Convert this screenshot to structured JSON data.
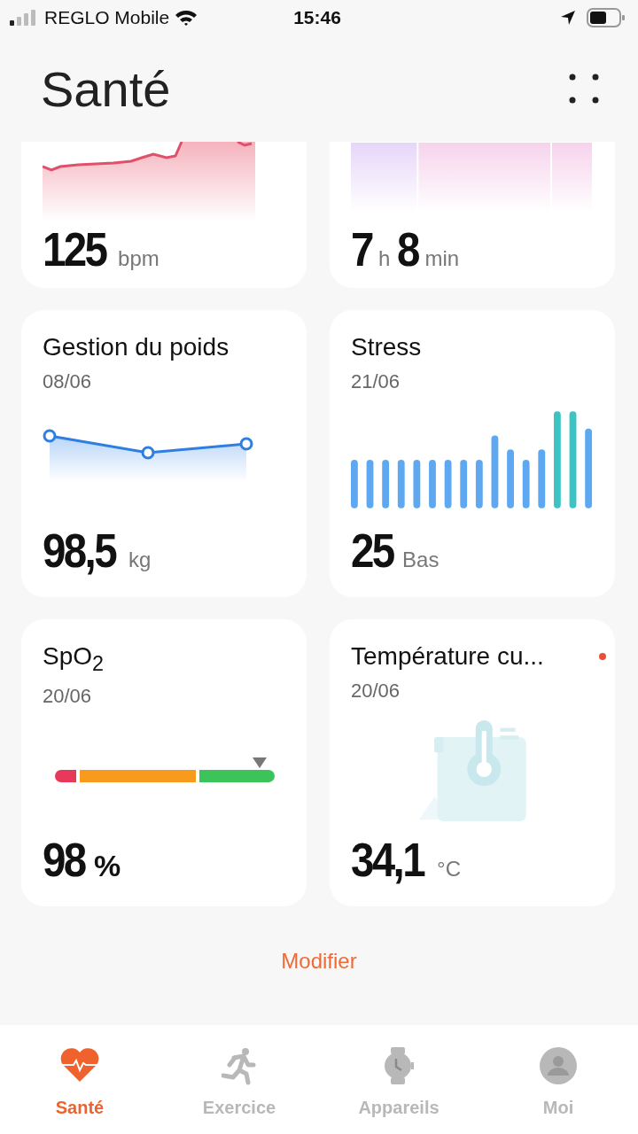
{
  "status_bar": {
    "carrier": "REGLO Mobile",
    "time": "15:46"
  },
  "header": {
    "title": "Santé"
  },
  "cards": [
    {
      "kind": "heart",
      "cut": true,
      "value": [
        {
          "text": "125",
          "kind": "number"
        },
        {
          "text": "bpm",
          "kind": "unit"
        }
      ]
    },
    {
      "kind": "sleep",
      "cut": true,
      "value": [
        {
          "text": "7",
          "kind": "number"
        },
        {
          "text": "h",
          "kind": "unit"
        },
        {
          "text": "8",
          "kind": "number"
        },
        {
          "text": "min",
          "kind": "unit"
        }
      ]
    },
    {
      "kind": "weight",
      "cut": false,
      "title": "Gestion du poids",
      "date": "08/06",
      "value": [
        {
          "text": "98,5",
          "kind": "number"
        },
        {
          "text": "kg",
          "kind": "unit"
        }
      ]
    },
    {
      "kind": "stress",
      "cut": false,
      "title": "Stress",
      "date": "21/06",
      "value": [
        {
          "text": "25",
          "kind": "number"
        },
        {
          "text": "Bas",
          "kind": "unit"
        }
      ]
    },
    {
      "kind": "spo2",
      "cut": false,
      "title": "SpO$_{2}$",
      "date": "20/06",
      "level": 0.93,
      "value": [
        {
          "text": "98",
          "kind": "number"
        },
        {
          "text": "%",
          "kind": "unit-dark"
        }
      ]
    },
    {
      "kind": "temperature",
      "cut": false,
      "title": "Température cu...",
      "date": "20/06",
      "unread": true,
      "value": [
        {
          "text": "34,1",
          "kind": "number"
        },
        {
          "text": "°C",
          "kind": "unit"
        }
      ]
    }
  ],
  "edit_link": "Modifier",
  "tabs": [
    {
      "label": "Santé",
      "kind": "heart",
      "selected": true
    },
    {
      "label": "Exercice",
      "kind": "runner",
      "selected": false
    },
    {
      "label": "Appareils",
      "kind": "watch",
      "selected": false
    },
    {
      "label": "Moi",
      "kind": "person",
      "selected": false
    }
  ]
}
